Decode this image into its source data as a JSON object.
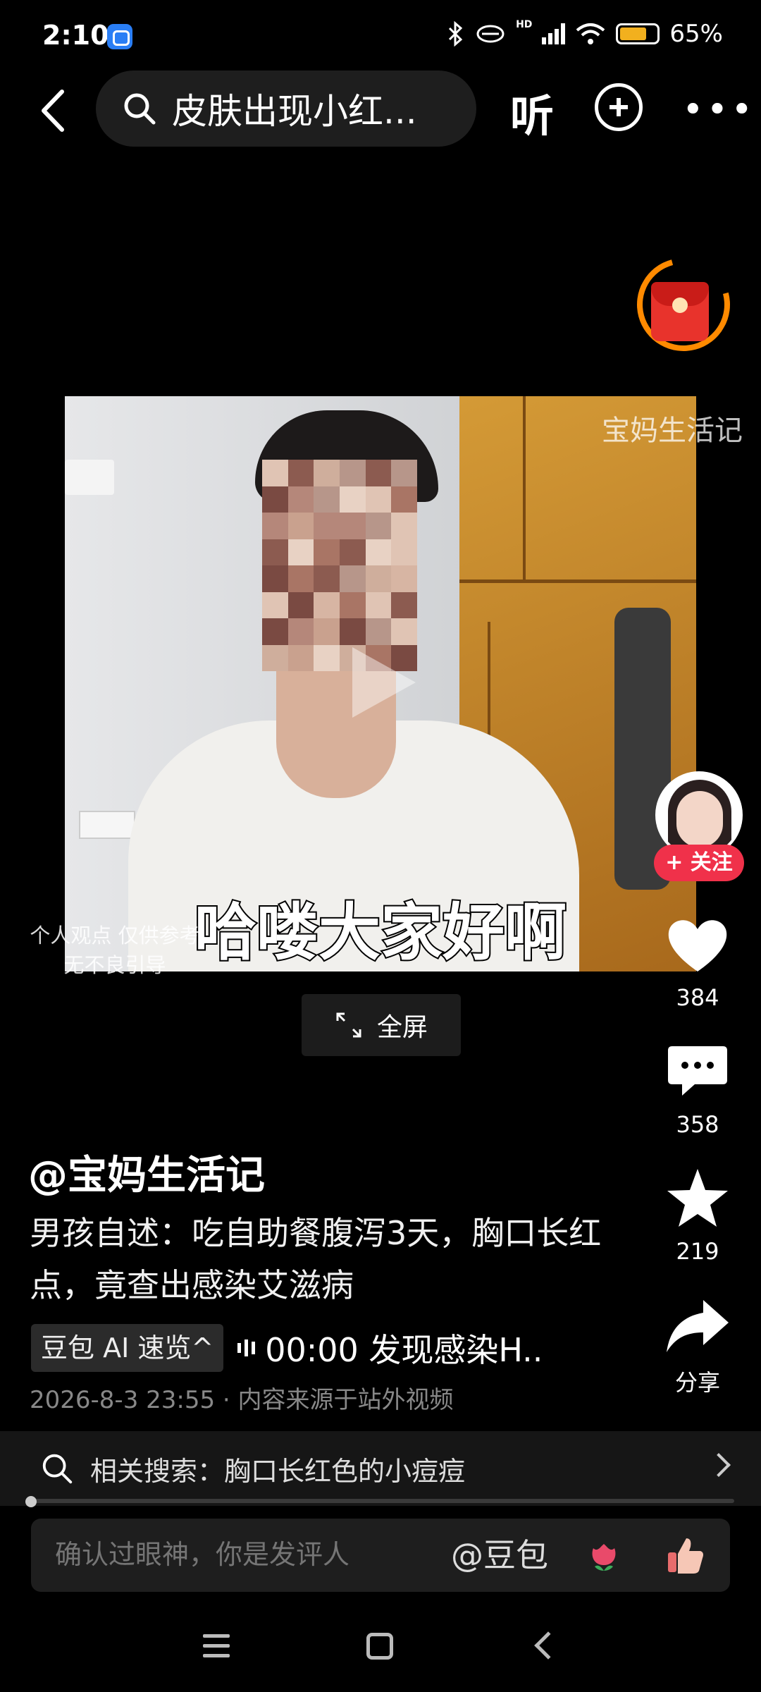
{
  "status_bar": {
    "time": "2:10",
    "network_label": "HD",
    "battery_percent": "65%",
    "battery_level": 0.65,
    "icons": [
      "app-notification-icon",
      "bluetooth-icon",
      "nfc-icon",
      "signal-icon",
      "wifi-icon",
      "battery-icon"
    ]
  },
  "top_bar": {
    "search_text": "皮肤出现小红...",
    "listen_label": "听"
  },
  "video": {
    "watermark": "宝妈生活记",
    "caption": "哈喽大家好啊",
    "disclaimer": "个人观点 仅供参考\n无不良引导",
    "fullscreen_label": "全屏"
  },
  "rail": {
    "follow_label": "+ 关注",
    "likes": "384",
    "comments": "358",
    "favorites": "219",
    "share_label": "分享"
  },
  "post": {
    "author": "@宝妈生活记",
    "description": "男孩自述：吃自助餐腹泻3天，胸口长红点，竟查出感染艾滋病",
    "ai_chip": "豆包 AI 速览^",
    "ai_summary": "00:00 发现感染H..",
    "meta": "2026-8-3 23:55 · 内容来源于站外视频"
  },
  "related": {
    "text": "相关搜索：胸口长红色的小痘痘"
  },
  "playback": {
    "progress": 0.01
  },
  "comment_bar": {
    "placeholder": "确认过眼神，你是发评人",
    "mention": "@豆包"
  },
  "colors": {
    "accent_red": "#f0314a",
    "envelope_red": "#e8332c",
    "timer_orange": "#ff8a00",
    "battery_yellow": "#f2b01e"
  }
}
